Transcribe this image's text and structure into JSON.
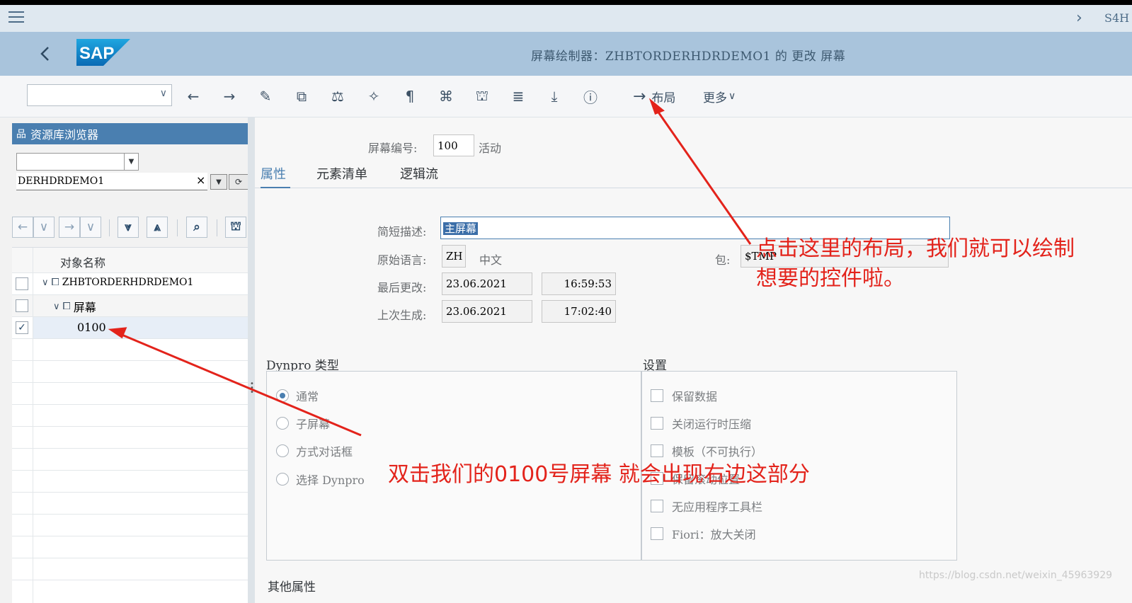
{
  "shell": {
    "system_id": "S4H"
  },
  "header": {
    "title": "屏幕绘制器：ZHBTORDERHDRDEMO1 的 更改 屏幕",
    "logo_text": "SAP"
  },
  "toolbar": {
    "command_field_value": "",
    "layout_label": "布局",
    "more_label": "更多"
  },
  "repository": {
    "title": "资源库浏览器",
    "object_type_value": "",
    "object_name_value": "DERHDRDEMO1",
    "column_header": "对象名称",
    "tree": [
      {
        "label": "ZHBTORDERHDRDEMO1",
        "checked": false
      },
      {
        "label": "屏幕",
        "checked": false
      },
      {
        "label": "0100",
        "checked": true
      }
    ]
  },
  "screen": {
    "number_label": "屏幕编号:",
    "number_value": "100",
    "status": "活动",
    "tabs": [
      "属性",
      "元素清单",
      "逻辑流"
    ],
    "active_tab": "属性",
    "attributes": {
      "desc_label": "简短描述:",
      "desc_value": "主屏幕",
      "orig_lang_label": "原始语言:",
      "orig_lang_code": "ZH",
      "orig_lang_name": "中文",
      "package_label": "包:",
      "package_value": "$TMP",
      "last_changed_label": "最后更改:",
      "last_changed_date": "23.06.2021",
      "last_changed_time": "16:59:53",
      "last_generated_label": "上次生成:",
      "last_generated_date": "23.06.2021",
      "last_generated_time": "17:02:40"
    },
    "dynpro_type": {
      "title": "Dynpro 类型",
      "options": [
        "通常",
        "子屏幕",
        "方式对话框",
        "选择 Dynpro"
      ],
      "selected": 0
    },
    "settings": {
      "title": "设置",
      "options": [
        "保留数据",
        "关闭运行时压缩",
        "模板（不可执行）",
        "保留滚动位置",
        "无应用程序工具栏",
        "Fiori：放大关闭"
      ]
    },
    "other_title": "其他属性"
  },
  "annotations": {
    "layout_note_line1": "点击这里的布局，我们就可以绘制",
    "layout_note_line2": "想要的控件啦。",
    "screen_note": "双击我们的0100号屏幕 就会出现右边这部分",
    "color": "#e3231b"
  },
  "watermark": "https://blog.csdn.net/weixin_45963929",
  "colors": {
    "title_bar": "#a9c4dc",
    "shell_bar": "#dfe8f0",
    "accent": "#4a7fb0"
  }
}
